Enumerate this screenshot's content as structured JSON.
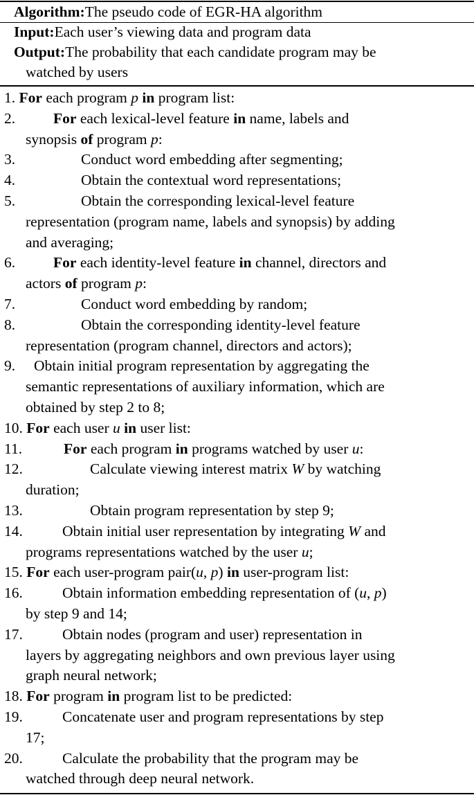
{
  "header": [
    [
      {
        "t": "Algorithm:",
        "b": true
      },
      {
        "t": "The pseudo code of EGR-HA algorithm"
      }
    ]
  ],
  "io": [
    {
      "lines": [
        [
          {
            "t": "Input:",
            "b": true
          },
          {
            "t": "Each user’s viewing data and program data"
          }
        ]
      ]
    },
    {
      "lines": [
        [
          {
            "t": "Output:",
            "b": true
          },
          {
            "t": "The probability that each candidate program may be"
          }
        ],
        [
          {
            "t": "watched by users"
          }
        ]
      ]
    }
  ],
  "steps": [
    {
      "num": "1. ",
      "inline": true,
      "lines": [
        [
          {
            "t": "For",
            "b": true
          },
          {
            "t": " each program "
          },
          {
            "t": "p",
            "i": true
          },
          {
            "t": " "
          },
          {
            "t": "in",
            "b": true
          },
          {
            "t": " program list:"
          }
        ]
      ]
    },
    {
      "num": "2.",
      "level": 2,
      "lines": [
        [
          {
            "t": "For",
            "b": true
          },
          {
            "t": " each lexical-level feature "
          },
          {
            "t": "in",
            "b": true
          },
          {
            "t": " name, labels and"
          }
        ],
        [
          {
            "t": "synopsis "
          },
          {
            "t": "of",
            "b": true
          },
          {
            "t": " program "
          },
          {
            "t": "p",
            "i": true
          },
          {
            "t": ":"
          }
        ]
      ]
    },
    {
      "num": "3.",
      "level": 3,
      "lines": [
        [
          {
            "t": "Conduct word embedding after segmenting;"
          }
        ]
      ]
    },
    {
      "num": "4.",
      "level": 3,
      "lines": [
        [
          {
            "t": "Obtain the contextual word representations;"
          }
        ]
      ]
    },
    {
      "num": "5.",
      "level": 3,
      "lines": [
        [
          {
            "t": "Obtain the corresponding lexical-level feature"
          }
        ],
        [
          {
            "t": "representation (program name, labels and synopsis) by adding"
          }
        ],
        [
          {
            "t": "and averaging;"
          }
        ]
      ]
    },
    {
      "num": "6.",
      "level": 2,
      "lines": [
        [
          {
            "t": "For",
            "b": true
          },
          {
            "t": " each identity-level feature "
          },
          {
            "t": "in",
            "b": true
          },
          {
            "t": " channel, directors and"
          }
        ],
        [
          {
            "t": "actors "
          },
          {
            "t": "of",
            "b": true
          },
          {
            "t": " program "
          },
          {
            "t": "p",
            "i": true
          },
          {
            "t": ":"
          }
        ]
      ]
    },
    {
      "num": "7.",
      "level": 3,
      "lines": [
        [
          {
            "t": "Conduct word embedding by random;"
          }
        ]
      ]
    },
    {
      "num": "8.",
      "level": 3,
      "lines": [
        [
          {
            "t": "Obtain the corresponding identity-level feature"
          }
        ],
        [
          {
            "t": "representation (program channel, directors and actors);"
          }
        ]
      ]
    },
    {
      "num": "9.",
      "level": 1,
      "lines": [
        [
          {
            "t": "Obtain initial program representation by aggregating the"
          }
        ],
        [
          {
            "t": "semantic representations of auxiliary information, which are"
          }
        ],
        [
          {
            "t": "obtained by step 2 to 8;"
          }
        ]
      ]
    },
    {
      "num": "10. ",
      "inline": true,
      "lines": [
        [
          {
            "t": "For",
            "b": true
          },
          {
            "t": " each user "
          },
          {
            "t": "u",
            "i": true
          },
          {
            "t": " "
          },
          {
            "t": "in",
            "b": true
          },
          {
            "t": " user list:"
          }
        ]
      ]
    },
    {
      "num": "11.",
      "level": 4,
      "lines": [
        [
          {
            "t": "For",
            "b": true
          },
          {
            "t": " each program "
          },
          {
            "t": "in",
            "b": true
          },
          {
            "t": " programs watched by user "
          },
          {
            "t": "u",
            "i": true
          },
          {
            "t": ":"
          }
        ]
      ]
    },
    {
      "num": "12.",
      "level": 5,
      "lines": [
        [
          {
            "t": "Calculate viewing interest matrix "
          },
          {
            "t": "W",
            "i": true
          },
          {
            "t": " by watching"
          }
        ],
        [
          {
            "t": "duration;"
          }
        ]
      ]
    },
    {
      "num": "13.",
      "level": 5,
      "lines": [
        [
          {
            "t": "Obtain program representation by step 9;"
          }
        ]
      ]
    },
    {
      "num": "14.",
      "level": 6,
      "lines": [
        [
          {
            "t": "Obtain initial user representation by integrating "
          },
          {
            "t": "W",
            "i": true
          },
          {
            "t": " and"
          }
        ],
        [
          {
            "t": "programs representations watched by the user "
          },
          {
            "t": "u",
            "i": true
          },
          {
            "t": ";"
          }
        ]
      ]
    },
    {
      "num": "15. ",
      "inline": true,
      "lines": [
        [
          {
            "t": "For",
            "b": true
          },
          {
            "t": " each user-program pair("
          },
          {
            "t": "u",
            "i": true
          },
          {
            "t": ", "
          },
          {
            "t": "p",
            "i": true
          },
          {
            "t": ") "
          },
          {
            "t": "in",
            "b": true
          },
          {
            "t": " user-program list:"
          }
        ]
      ]
    },
    {
      "num": "16.",
      "level": 6,
      "lines": [
        [
          {
            "t": "Obtain information embedding representation of ("
          },
          {
            "t": "u",
            "i": true
          },
          {
            "t": ", "
          },
          {
            "t": "p",
            "i": true
          },
          {
            "t": ")"
          }
        ],
        [
          {
            "t": "by step 9 and 14;"
          }
        ]
      ]
    },
    {
      "num": "17.",
      "level": 6,
      "lines": [
        [
          {
            "t": "Obtain nodes (program and user) representation in"
          }
        ],
        [
          {
            "t": "layers by aggregating neighbors and own previous layer using"
          }
        ],
        [
          {
            "t": "graph neural network;"
          }
        ]
      ]
    },
    {
      "num": "18. ",
      "inline": true,
      "lines": [
        [
          {
            "t": "For",
            "b": true
          },
          {
            "t": " program "
          },
          {
            "t": "in",
            "b": true
          },
          {
            "t": " program list to be predicted:"
          }
        ]
      ]
    },
    {
      "num": "19.",
      "level": 6,
      "lines": [
        [
          {
            "t": "Concatenate user and program representations by step"
          }
        ],
        [
          {
            "t": "17;"
          }
        ]
      ]
    },
    {
      "num": "20.",
      "level": 6,
      "lines": [
        [
          {
            "t": "Calculate the probability that the program may be"
          }
        ],
        [
          {
            "t": "watched through deep neural network."
          }
        ]
      ]
    }
  ]
}
